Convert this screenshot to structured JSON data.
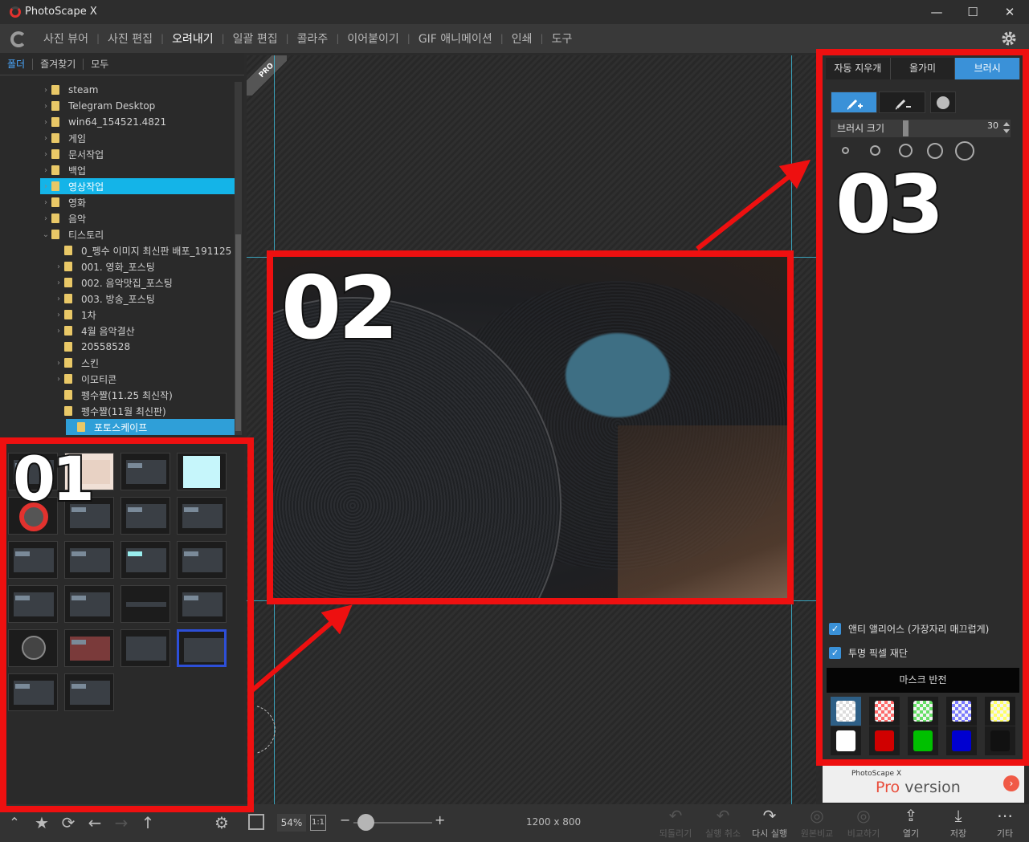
{
  "window": {
    "title": "PhotoScape X",
    "minimize": "—",
    "maximize": "☐",
    "close": "✕"
  },
  "menu": {
    "items": [
      "사진 뷰어",
      "사진 편집",
      "오려내기",
      "일괄 편집",
      "콜라주",
      "이어붙이기",
      "GIF 애니메이션",
      "인쇄",
      "도구"
    ],
    "active_index": 2
  },
  "left": {
    "tabs": [
      "폴더",
      "즐겨찾기",
      "모두"
    ],
    "tree": [
      {
        "label": "steam",
        "arrow": "›",
        "indent": 1
      },
      {
        "label": "Telegram Desktop",
        "arrow": "›",
        "indent": 1
      },
      {
        "label": "win64_154521.4821",
        "arrow": "›",
        "indent": 1
      },
      {
        "label": "게임",
        "arrow": "›",
        "indent": 1
      },
      {
        "label": "문서작업",
        "arrow": "›",
        "indent": 1
      },
      {
        "label": "백업",
        "arrow": "›",
        "indent": 1
      },
      {
        "label": "영상작업",
        "arrow": "›",
        "indent": 1,
        "state": "selected"
      },
      {
        "label": "영화",
        "arrow": "›",
        "indent": 1
      },
      {
        "label": "음악",
        "arrow": "›",
        "indent": 1
      },
      {
        "label": "티스토리",
        "arrow": "⌄",
        "indent": 1
      },
      {
        "label": "0_펭수 이미지 최신판 배포_191125",
        "arrow": "",
        "indent": 2
      },
      {
        "label": "001. 영화_포스팅",
        "arrow": "›",
        "indent": 2
      },
      {
        "label": "002. 음악맛집_포스팅",
        "arrow": "›",
        "indent": 2
      },
      {
        "label": "003. 방송_포스팅",
        "arrow": "›",
        "indent": 2
      },
      {
        "label": "1차",
        "arrow": "›",
        "indent": 2
      },
      {
        "label": "4월 음악결산",
        "arrow": "›",
        "indent": 2
      },
      {
        "label": "20558528",
        "arrow": "",
        "indent": 2
      },
      {
        "label": "스킨",
        "arrow": "›",
        "indent": 2
      },
      {
        "label": "이모티콘",
        "arrow": "›",
        "indent": 2
      },
      {
        "label": "펭수짤(11.25 최신작)",
        "arrow": "",
        "indent": 2
      },
      {
        "label": "펭수짤(11월 최신판)",
        "arrow": "",
        "indent": 2
      },
      {
        "label": "포토스케이프",
        "arrow": "",
        "indent": 2,
        "state": "current"
      }
    ]
  },
  "canvas": {
    "badge": "PRO",
    "zoom": "54%",
    "one_to_one": "1:1",
    "image_size": "1200 x 800"
  },
  "annotations": {
    "n1": "01",
    "n2": "02",
    "n3": "03"
  },
  "right": {
    "tabs": [
      "자동 지우개",
      "올가미",
      "브러시"
    ],
    "active_tab": 2,
    "brush_size_label": "브러시 크기",
    "brush_size_value": "30",
    "anti_alias": "앤티 앨리어스 (가장자리 매끄럽게)",
    "transparent_cut": "투명 픽셀 재단",
    "mask_invert": "마스크 반전",
    "mask_colors": [
      "checker",
      "#ff6a6a",
      "#66e066",
      "#7a7aff",
      "#ffff66",
      "#ffffff",
      "#d00000",
      "#00c000",
      "#0000d0",
      "#111111"
    ]
  },
  "ad": {
    "small": "PhotoScape X",
    "pro": "Pro",
    "version": " version"
  },
  "bottom": {
    "actions": [
      {
        "label": "되돌리기",
        "icon": "↶",
        "dim": true
      },
      {
        "label": "실행 취소",
        "icon": "↶",
        "dim": true
      },
      {
        "label": "다시 실행",
        "icon": "↷",
        "dim": false
      },
      {
        "label": "원본비교",
        "icon": "◎",
        "dim": true
      },
      {
        "label": "비교하기",
        "icon": "◎",
        "dim": true
      },
      {
        "label": "열기",
        "icon": "⇪",
        "dim": false
      },
      {
        "label": "저장",
        "icon": "⤓",
        "dim": false
      },
      {
        "label": "기타",
        "icon": "⋯",
        "dim": false
      }
    ]
  }
}
